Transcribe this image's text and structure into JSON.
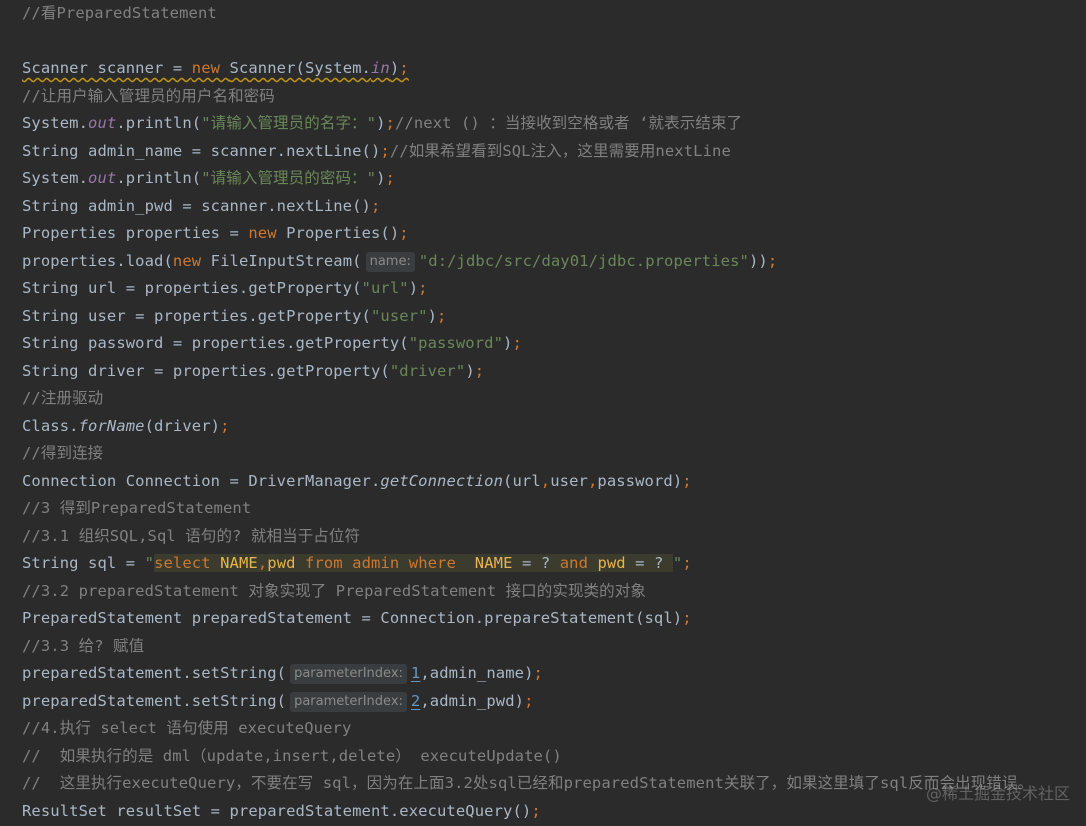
{
  "editor": {
    "lines": [
      [
        {
          "t": "//看PreparedStatement",
          "c": "com"
        }
      ],
      [],
      [
        {
          "t": "Scanner scanner = ",
          "c": "plain",
          "sq": true
        },
        {
          "t": "new ",
          "c": "key",
          "sq": true
        },
        {
          "t": "Scanner(System.",
          "c": "plain",
          "sq": true
        },
        {
          "t": "in",
          "c": "fld",
          "sq": true
        },
        {
          "t": ")",
          "c": "plain",
          "sq": true
        },
        {
          "t": ";",
          "c": "key",
          "sq": true
        }
      ],
      [
        {
          "t": "//让用户输入管理员的用户名和密码",
          "c": "com"
        }
      ],
      [
        {
          "t": "System.",
          "c": "plain"
        },
        {
          "t": "out",
          "c": "fld"
        },
        {
          "t": ".println(",
          "c": "plain"
        },
        {
          "t": "\"请输入管理员的名字：\"",
          "c": "str"
        },
        {
          "t": ")",
          "c": "plain"
        },
        {
          "t": ";",
          "c": "key"
        },
        {
          "t": "//next () ：当接收到空格或者 ‘就表示结束了",
          "c": "com"
        }
      ],
      [
        {
          "t": "String admin_name = scanner.nextLine()",
          "c": "plain"
        },
        {
          "t": ";",
          "c": "key"
        },
        {
          "t": "//如果希望看到SQL注入，这里需要用nextLine",
          "c": "com"
        }
      ],
      [
        {
          "t": "System.",
          "c": "plain"
        },
        {
          "t": "out",
          "c": "fld"
        },
        {
          "t": ".println(",
          "c": "plain"
        },
        {
          "t": "\"请输入管理员的密码：\"",
          "c": "str"
        },
        {
          "t": ")",
          "c": "plain"
        },
        {
          "t": ";",
          "c": "key"
        }
      ],
      [
        {
          "t": "String admin_pwd = scanner.nextLine()",
          "c": "plain"
        },
        {
          "t": ";",
          "c": "key"
        }
      ],
      [
        {
          "t": "Properties properties = ",
          "c": "plain"
        },
        {
          "t": "new ",
          "c": "key"
        },
        {
          "t": "Properties()",
          "c": "plain"
        },
        {
          "t": ";",
          "c": "key"
        }
      ],
      [
        {
          "t": "properties.load(",
          "c": "plain"
        },
        {
          "t": "new ",
          "c": "key"
        },
        {
          "t": "FileInputStream(",
          "c": "plain"
        },
        {
          "t": "name:",
          "c": "hint"
        },
        {
          "t": "\"d:/jdbc/src/day01/jdbc.properties\"",
          "c": "str"
        },
        {
          "t": "))",
          "c": "plain"
        },
        {
          "t": ";",
          "c": "key"
        }
      ],
      [
        {
          "t": "String url = properties.getProperty(",
          "c": "plain"
        },
        {
          "t": "\"url\"",
          "c": "str"
        },
        {
          "t": ")",
          "c": "plain"
        },
        {
          "t": ";",
          "c": "key"
        }
      ],
      [
        {
          "t": "String user = properties.getProperty(",
          "c": "plain"
        },
        {
          "t": "\"user\"",
          "c": "str"
        },
        {
          "t": ")",
          "c": "plain"
        },
        {
          "t": ";",
          "c": "key"
        }
      ],
      [
        {
          "t": "String password = properties.getProperty(",
          "c": "plain"
        },
        {
          "t": "\"password\"",
          "c": "str"
        },
        {
          "t": ")",
          "c": "plain"
        },
        {
          "t": ";",
          "c": "key"
        }
      ],
      [
        {
          "t": "String driver = properties.getProperty(",
          "c": "plain"
        },
        {
          "t": "\"driver\"",
          "c": "str"
        },
        {
          "t": ")",
          "c": "plain"
        },
        {
          "t": ";",
          "c": "key"
        }
      ],
      [
        {
          "t": "//注册驱动",
          "c": "com"
        }
      ],
      [
        {
          "t": "Class.",
          "c": "plain"
        },
        {
          "t": "forName",
          "c": "ital"
        },
        {
          "t": "(driver)",
          "c": "plain"
        },
        {
          "t": ";",
          "c": "key"
        }
      ],
      [
        {
          "t": "//得到连接",
          "c": "com"
        }
      ],
      [
        {
          "t": "Connection Connection = DriverManager.",
          "c": "plain"
        },
        {
          "t": "getConnection",
          "c": "ital"
        },
        {
          "t": "(url",
          "c": "plain"
        },
        {
          "t": ",",
          "c": "key"
        },
        {
          "t": "user",
          "c": "plain"
        },
        {
          "t": ",",
          "c": "key"
        },
        {
          "t": "password)",
          "c": "plain"
        },
        {
          "t": ";",
          "c": "key"
        }
      ],
      [
        {
          "t": "//3 得到PreparedStatement",
          "c": "com"
        }
      ],
      [
        {
          "t": "//3.1 组织SQL,Sql 语句的? 就相当于占位符",
          "c": "com"
        }
      ],
      [
        {
          "t": "String sql = ",
          "c": "plain"
        },
        {
          "t": "\"",
          "c": "str"
        },
        {
          "t": "select ",
          "c": "sqlk",
          "bg": true
        },
        {
          "t": "NAME",
          "c": "sql",
          "bg": true
        },
        {
          "t": ",",
          "c": "sqlk",
          "bg": true
        },
        {
          "t": "pwd ",
          "c": "sql",
          "bg": true
        },
        {
          "t": "from ",
          "c": "sqlk",
          "bg": true
        },
        {
          "t": "admin ",
          "c": "sqlk",
          "bg": true
        },
        {
          "t": "where  ",
          "c": "sqlk",
          "bg": true
        },
        {
          "t": "NAME ",
          "c": "sql",
          "bg": true
        },
        {
          "t": "= ? ",
          "c": "plain",
          "bg": true
        },
        {
          "t": "and ",
          "c": "sqlk",
          "bg": true
        },
        {
          "t": "pwd ",
          "c": "sql",
          "bg": true
        },
        {
          "t": "= ? ",
          "c": "plain",
          "bg": true
        },
        {
          "t": "\"",
          "c": "str"
        },
        {
          "t": ";",
          "c": "key"
        }
      ],
      [
        {
          "t": "//3.2 preparedStatement 对象实现了 PreparedStatement 接口的实现类的对象",
          "c": "com"
        }
      ],
      [
        {
          "t": "PreparedStatement preparedStatement = Connection.prepareStatement(sql)",
          "c": "plain"
        },
        {
          "t": ";",
          "c": "key"
        }
      ],
      [
        {
          "t": "//3.3 给? 赋值",
          "c": "com"
        }
      ],
      [
        {
          "t": "preparedStatement.setString(",
          "c": "plain"
        },
        {
          "t": "parameterIndex:",
          "c": "hint"
        },
        {
          "t": "1",
          "c": "num"
        },
        {
          "t": ",admin_name)",
          "c": "plain"
        },
        {
          "t": ";",
          "c": "key"
        }
      ],
      [
        {
          "t": "preparedStatement.setString(",
          "c": "plain"
        },
        {
          "t": "parameterIndex:",
          "c": "hint"
        },
        {
          "t": "2",
          "c": "num"
        },
        {
          "t": ",admin_pwd)",
          "c": "plain"
        },
        {
          "t": ";",
          "c": "key"
        }
      ],
      [
        {
          "t": "//4.执行 select 语句使用 executeQuery",
          "c": "com"
        }
      ],
      [
        {
          "t": "//  如果执行的是 dml（update,insert,delete） executeUpdate()",
          "c": "com"
        }
      ],
      [
        {
          "t": "//  这里执行executeQuery，不要在写 sql，因为在上面3.2处sql已经和preparedStatement关联了，如果这里填了sql反而会出现错误。",
          "c": "com"
        }
      ],
      [
        {
          "t": "ResultSet resultSet = preparedStatement.executeQuery()",
          "c": "plain"
        },
        {
          "t": ";",
          "c": "key"
        }
      ]
    ]
  },
  "watermark": "@稀土掘金技术社区",
  "colors": {
    "background": "#2b2b2b",
    "plain": "#a9b7c6",
    "comment": "#808080",
    "keyword": "#cc7832",
    "string": "#6a8759",
    "field": "#9876aa",
    "number": "#6897bb"
  }
}
